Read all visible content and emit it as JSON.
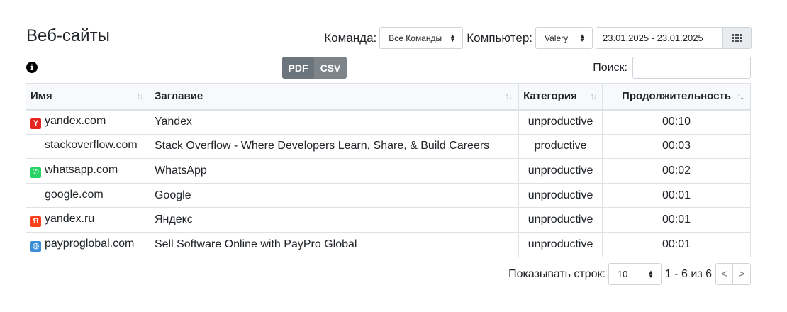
{
  "header": {
    "title": "Веб-сайты",
    "team_label": "Команда:",
    "team_value": "Все Команды",
    "computer_label": "Компьютер:",
    "computer_value": "Valery",
    "date_range": "23.01.2025 - 23.01.2025"
  },
  "toolbar": {
    "pdf_label": "PDF",
    "csv_label": "CSV",
    "search_label": "Поиск:",
    "search_value": ""
  },
  "table": {
    "columns": [
      "Имя",
      "Заглавие",
      "Категория",
      "Продолжительность"
    ],
    "rows": [
      {
        "icon": "yandex-icon",
        "site": "yandex.com",
        "title": "Yandex",
        "category": "unproductive",
        "duration": "00:10"
      },
      {
        "icon": "stackoverflow-icon",
        "site": "stackoverflow.com",
        "title": "Stack Overflow - Where Developers Learn, Share, & Build Careers",
        "category": "productive",
        "duration": "00:03"
      },
      {
        "icon": "whatsapp-icon",
        "site": "whatsapp.com",
        "title": "WhatsApp",
        "category": "unproductive",
        "duration": "00:02"
      },
      {
        "icon": "google-icon",
        "site": "google.com",
        "title": "Google",
        "category": "unproductive",
        "duration": "00:01"
      },
      {
        "icon": "yandex-ru-icon",
        "site": "yandex.ru",
        "title": "Яндекс",
        "category": "unproductive",
        "duration": "00:01"
      },
      {
        "icon": "globe-icon",
        "site": "payproglobal.com",
        "title": "Sell Software Online with PayPro Global",
        "category": "unproductive",
        "duration": "00:01"
      }
    ]
  },
  "pagination": {
    "rows_label": "Показывать строк:",
    "rows_value": "10",
    "info": "1 - 6 из 6",
    "prev": "<",
    "next": ">"
  }
}
